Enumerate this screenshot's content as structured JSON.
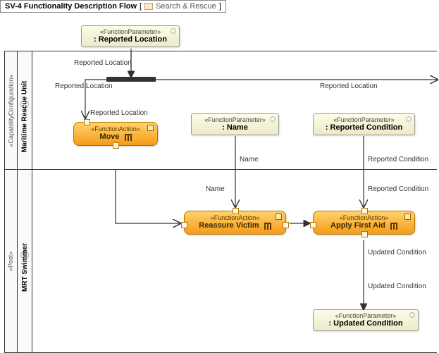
{
  "header": {
    "title": "SV-4 Functionality Description Flow",
    "context": "Search & Rescue"
  },
  "swimlanes": {
    "lane1": {
      "stereotype": "«CapabilityConfiguration»",
      "name": "Maritime Rescue Unit"
    },
    "lane2": {
      "stereotype": "«Post»",
      "name": "MRT Swimmer"
    }
  },
  "nodes": {
    "paramReportedLocation": {
      "stereotype": "«FunctionParameter»",
      "name": ": Reported Location"
    },
    "paramName": {
      "stereotype": "«FunctionParameter»",
      "name": ": Name"
    },
    "paramReportedCondition": {
      "stereotype": "«FunctionParameter»",
      "name": ": Reported Condition"
    },
    "paramUpdatedCondition": {
      "stereotype": "«FunctionParameter»",
      "name": ": Updated Condition"
    },
    "actionMove": {
      "stereotype": "«FunctionAction»",
      "name": "Move"
    },
    "actionReassure": {
      "stereotype": "«FunctionAction»",
      "name": "Reassure Victim"
    },
    "actionFirstAid": {
      "stereotype": "«FunctionAction»",
      "name": "Apply First Aid"
    }
  },
  "edges": {
    "e1": "Reported Location",
    "e2": "Reported Location",
    "e3": "Reported Location",
    "e4": "Reported Location",
    "e5": "Name",
    "e6": "Name",
    "e7": "Reported Condition",
    "e8": "Reported Condition",
    "e9": "Updated Condition",
    "e10": "Updated Condition"
  }
}
